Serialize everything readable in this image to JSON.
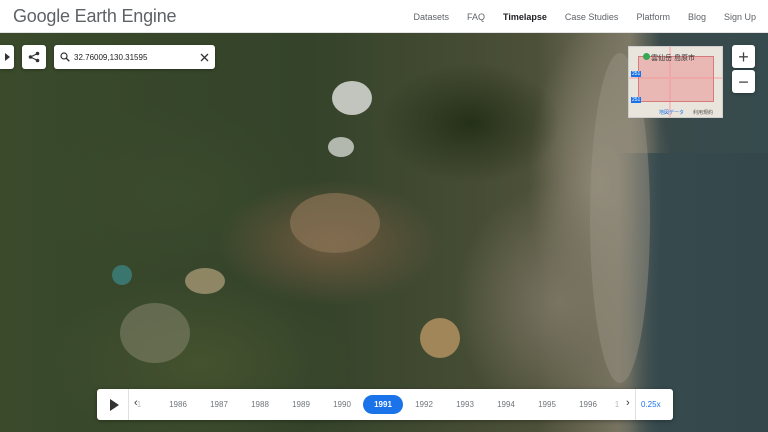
{
  "header": {
    "logo": "Google Earth Engine",
    "nav": [
      "Datasets",
      "FAQ",
      "Timelapse",
      "Case Studies",
      "Platform",
      "Blog",
      "Sign Up"
    ],
    "active_nav": "Timelapse"
  },
  "search": {
    "value": "32.76009,130.31595"
  },
  "minimap": {
    "place_label": "雲仙岳",
    "city_label": "島原市",
    "data_link": "地図データ",
    "terms": "利用規約",
    "route_num": "251"
  },
  "zoom": {
    "in": "+",
    "out": "−"
  },
  "timeline": {
    "years": [
      "1986",
      "1987",
      "1988",
      "1989",
      "1990",
      "1991",
      "1992",
      "1993",
      "1994",
      "1995",
      "1996"
    ],
    "selected_year": "1991",
    "speed": "0.25x",
    "partial_left": "1",
    "partial_right": "1"
  },
  "colors": {
    "accent": "#1a73e8",
    "header_bg": "#ffffff"
  }
}
